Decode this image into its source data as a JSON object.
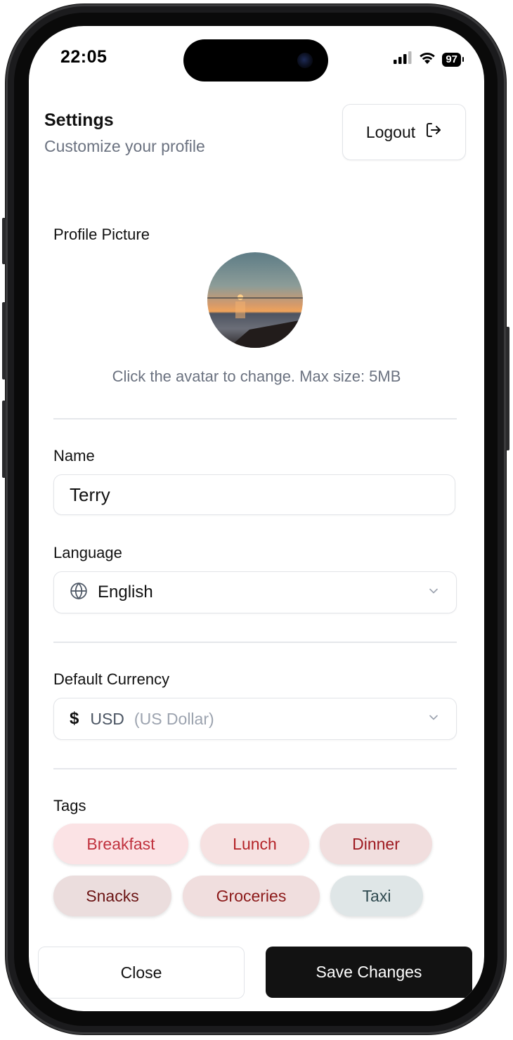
{
  "status_bar": {
    "time": "22:05",
    "battery": "97"
  },
  "header": {
    "title": "Settings",
    "subtitle": "Customize your profile",
    "logout_label": "Logout"
  },
  "profile": {
    "label": "Profile Picture",
    "hint": "Click the avatar to change. Max size: 5MB"
  },
  "name_field": {
    "label": "Name",
    "value": "Terry"
  },
  "language_field": {
    "label": "Language",
    "value": "English"
  },
  "currency_field": {
    "label": "Default Currency",
    "symbol": "$",
    "code": "USD",
    "name": "(US Dollar)"
  },
  "tags": {
    "label": "Tags",
    "items": [
      {
        "label": "Breakfast",
        "bg": "#fbe3e5",
        "fg": "#c0313d"
      },
      {
        "label": "Lunch",
        "bg": "#f6e1e1",
        "fg": "#b42328"
      },
      {
        "label": "Dinner",
        "bg": "#f1dede",
        "fg": "#9e1a21"
      },
      {
        "label": "Snacks",
        "bg": "#ebdddd",
        "fg": "#6b1414"
      },
      {
        "label": "Groceries",
        "bg": "#f0dede",
        "fg": "#8c1a1a"
      },
      {
        "label": "Taxi",
        "bg": "#dfe6e7",
        "fg": "#2f4a50"
      }
    ]
  },
  "footer": {
    "close_label": "Close",
    "save_label": "Save Changes"
  }
}
